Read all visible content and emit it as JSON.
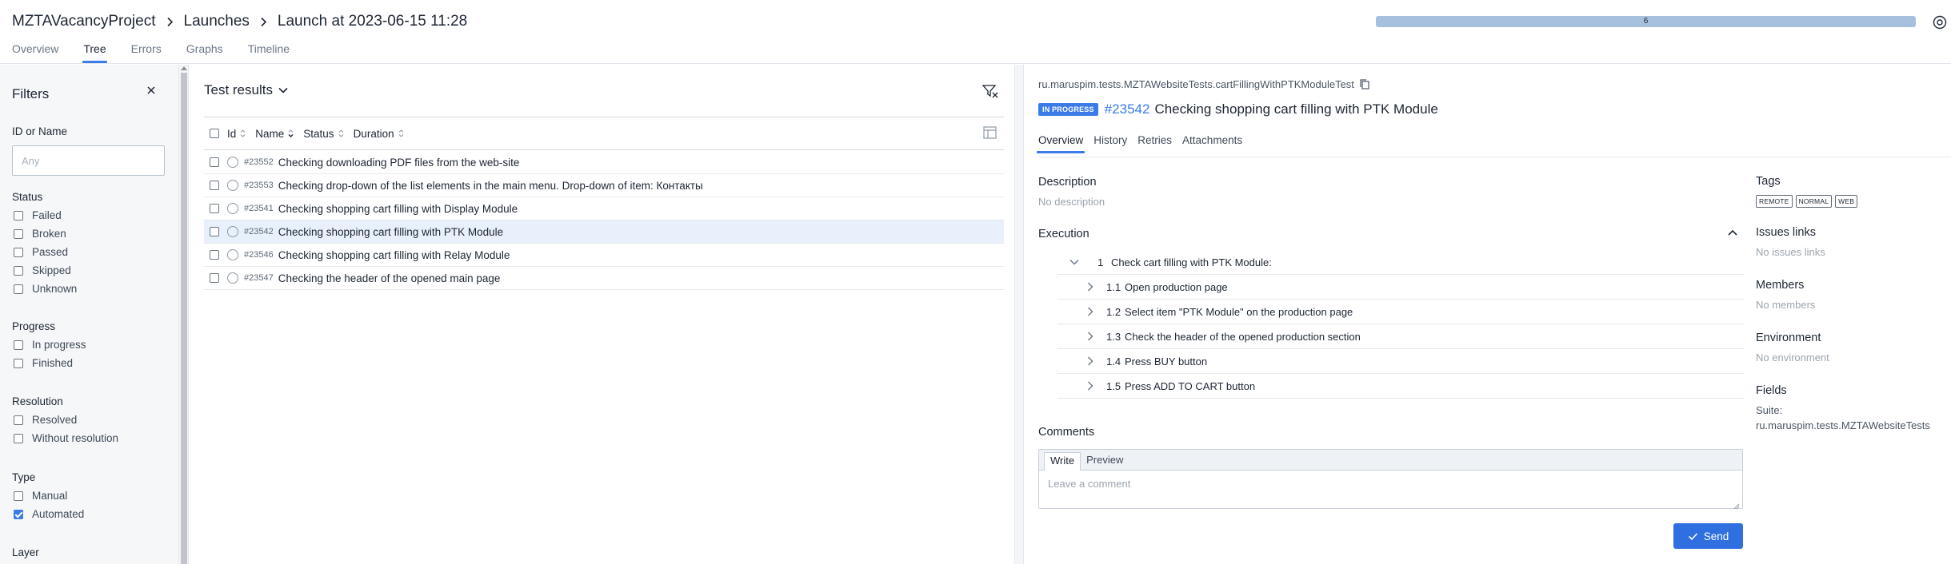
{
  "header": {
    "breadcrumbs": [
      "MZTAVacancyProject",
      "Launches",
      "Launch at 2023-06-15 11:28"
    ],
    "tabs": [
      "Overview",
      "Tree",
      "Errors",
      "Graphs",
      "Timeline"
    ],
    "active_tab": "Tree",
    "progress_label": "6",
    "progress_fraction": 1.0,
    "progress_color": "#a7c0dd"
  },
  "filters": {
    "title": "Filters",
    "id_or_name_label": "ID or Name",
    "id_or_name_placeholder": "Any",
    "sections": [
      {
        "title": "Status",
        "options": [
          {
            "label": "Failed",
            "checked": false
          },
          {
            "label": "Broken",
            "checked": false
          },
          {
            "label": "Passed",
            "checked": false
          },
          {
            "label": "Skipped",
            "checked": false
          },
          {
            "label": "Unknown",
            "checked": false
          }
        ]
      },
      {
        "title": "Progress",
        "options": [
          {
            "label": "In progress",
            "checked": false
          },
          {
            "label": "Finished",
            "checked": false
          }
        ]
      },
      {
        "title": "Resolution",
        "options": [
          {
            "label": "Resolved",
            "checked": false
          },
          {
            "label": "Without resolution",
            "checked": false
          }
        ]
      },
      {
        "title": "Type",
        "options": [
          {
            "label": "Manual",
            "checked": false
          },
          {
            "label": "Automated",
            "checked": true
          }
        ]
      },
      {
        "title": "Layer",
        "options": []
      }
    ]
  },
  "results": {
    "title": "Test results",
    "columns": [
      "Id",
      "Name",
      "Status",
      "Duration"
    ],
    "rows": [
      {
        "id": "#23552",
        "name": "Checking downloading PDF files from the web-site",
        "selected": false
      },
      {
        "id": "#23553",
        "name": "Checking drop-down of the list elements in the main menu. Drop-down of item: Контакты",
        "selected": false
      },
      {
        "id": "#23541",
        "name": "Checking shopping cart filling with Display Module",
        "selected": false
      },
      {
        "id": "#23542",
        "name": "Checking shopping cart filling with PTK Module",
        "selected": true
      },
      {
        "id": "#23546",
        "name": "Checking shopping cart filling with Relay Module",
        "selected": false
      },
      {
        "id": "#23547",
        "name": "Checking the header of the opened main page",
        "selected": false
      }
    ]
  },
  "detail": {
    "path": "ru.maruspim.tests.MZTAWebsiteTests.cartFillingWithPTKModuleTest",
    "status_badge": "IN PROGRESS",
    "id": "#23542",
    "name": "Checking shopping cart filling with PTK Module",
    "tabs": [
      "Overview",
      "History",
      "Retries",
      "Attachments"
    ],
    "active_tab": "Overview",
    "description_title": "Description",
    "description_value": "No description",
    "execution_title": "Execution",
    "steps": [
      {
        "num": "1",
        "text": "Check cart filling with PTK Module:",
        "level": 0,
        "expanded": true
      },
      {
        "num": "1.1",
        "text": "Open production page",
        "level": 1
      },
      {
        "num": "1.2",
        "text": "Select item \"PTK Module\" on the production page",
        "level": 1
      },
      {
        "num": "1.3",
        "text": "Check the header of the opened production section",
        "level": 1
      },
      {
        "num": "1.4",
        "text": "Press BUY button",
        "level": 1
      },
      {
        "num": "1.5",
        "text": "Press ADD TO CART button",
        "level": 1
      }
    ],
    "comments": {
      "title": "Comments",
      "tab_write": "Write",
      "tab_preview": "Preview",
      "placeholder": "Leave a comment",
      "send_label": "Send"
    },
    "side": {
      "tags_title": "Tags",
      "tags": [
        "REMOTE",
        "NORMAL",
        "WEB"
      ],
      "issues_title": "Issues links",
      "issues_value": "No issues links",
      "members_title": "Members",
      "members_value": "No members",
      "environment_title": "Environment",
      "environment_value": "No environment",
      "fields_title": "Fields",
      "fields_key": "Suite:",
      "fields_value": "ru.maruspim.tests.MZTAWebsiteTests"
    }
  },
  "colors": {
    "accent": "#3b7be8",
    "selected_row": "#e8f1fb"
  }
}
